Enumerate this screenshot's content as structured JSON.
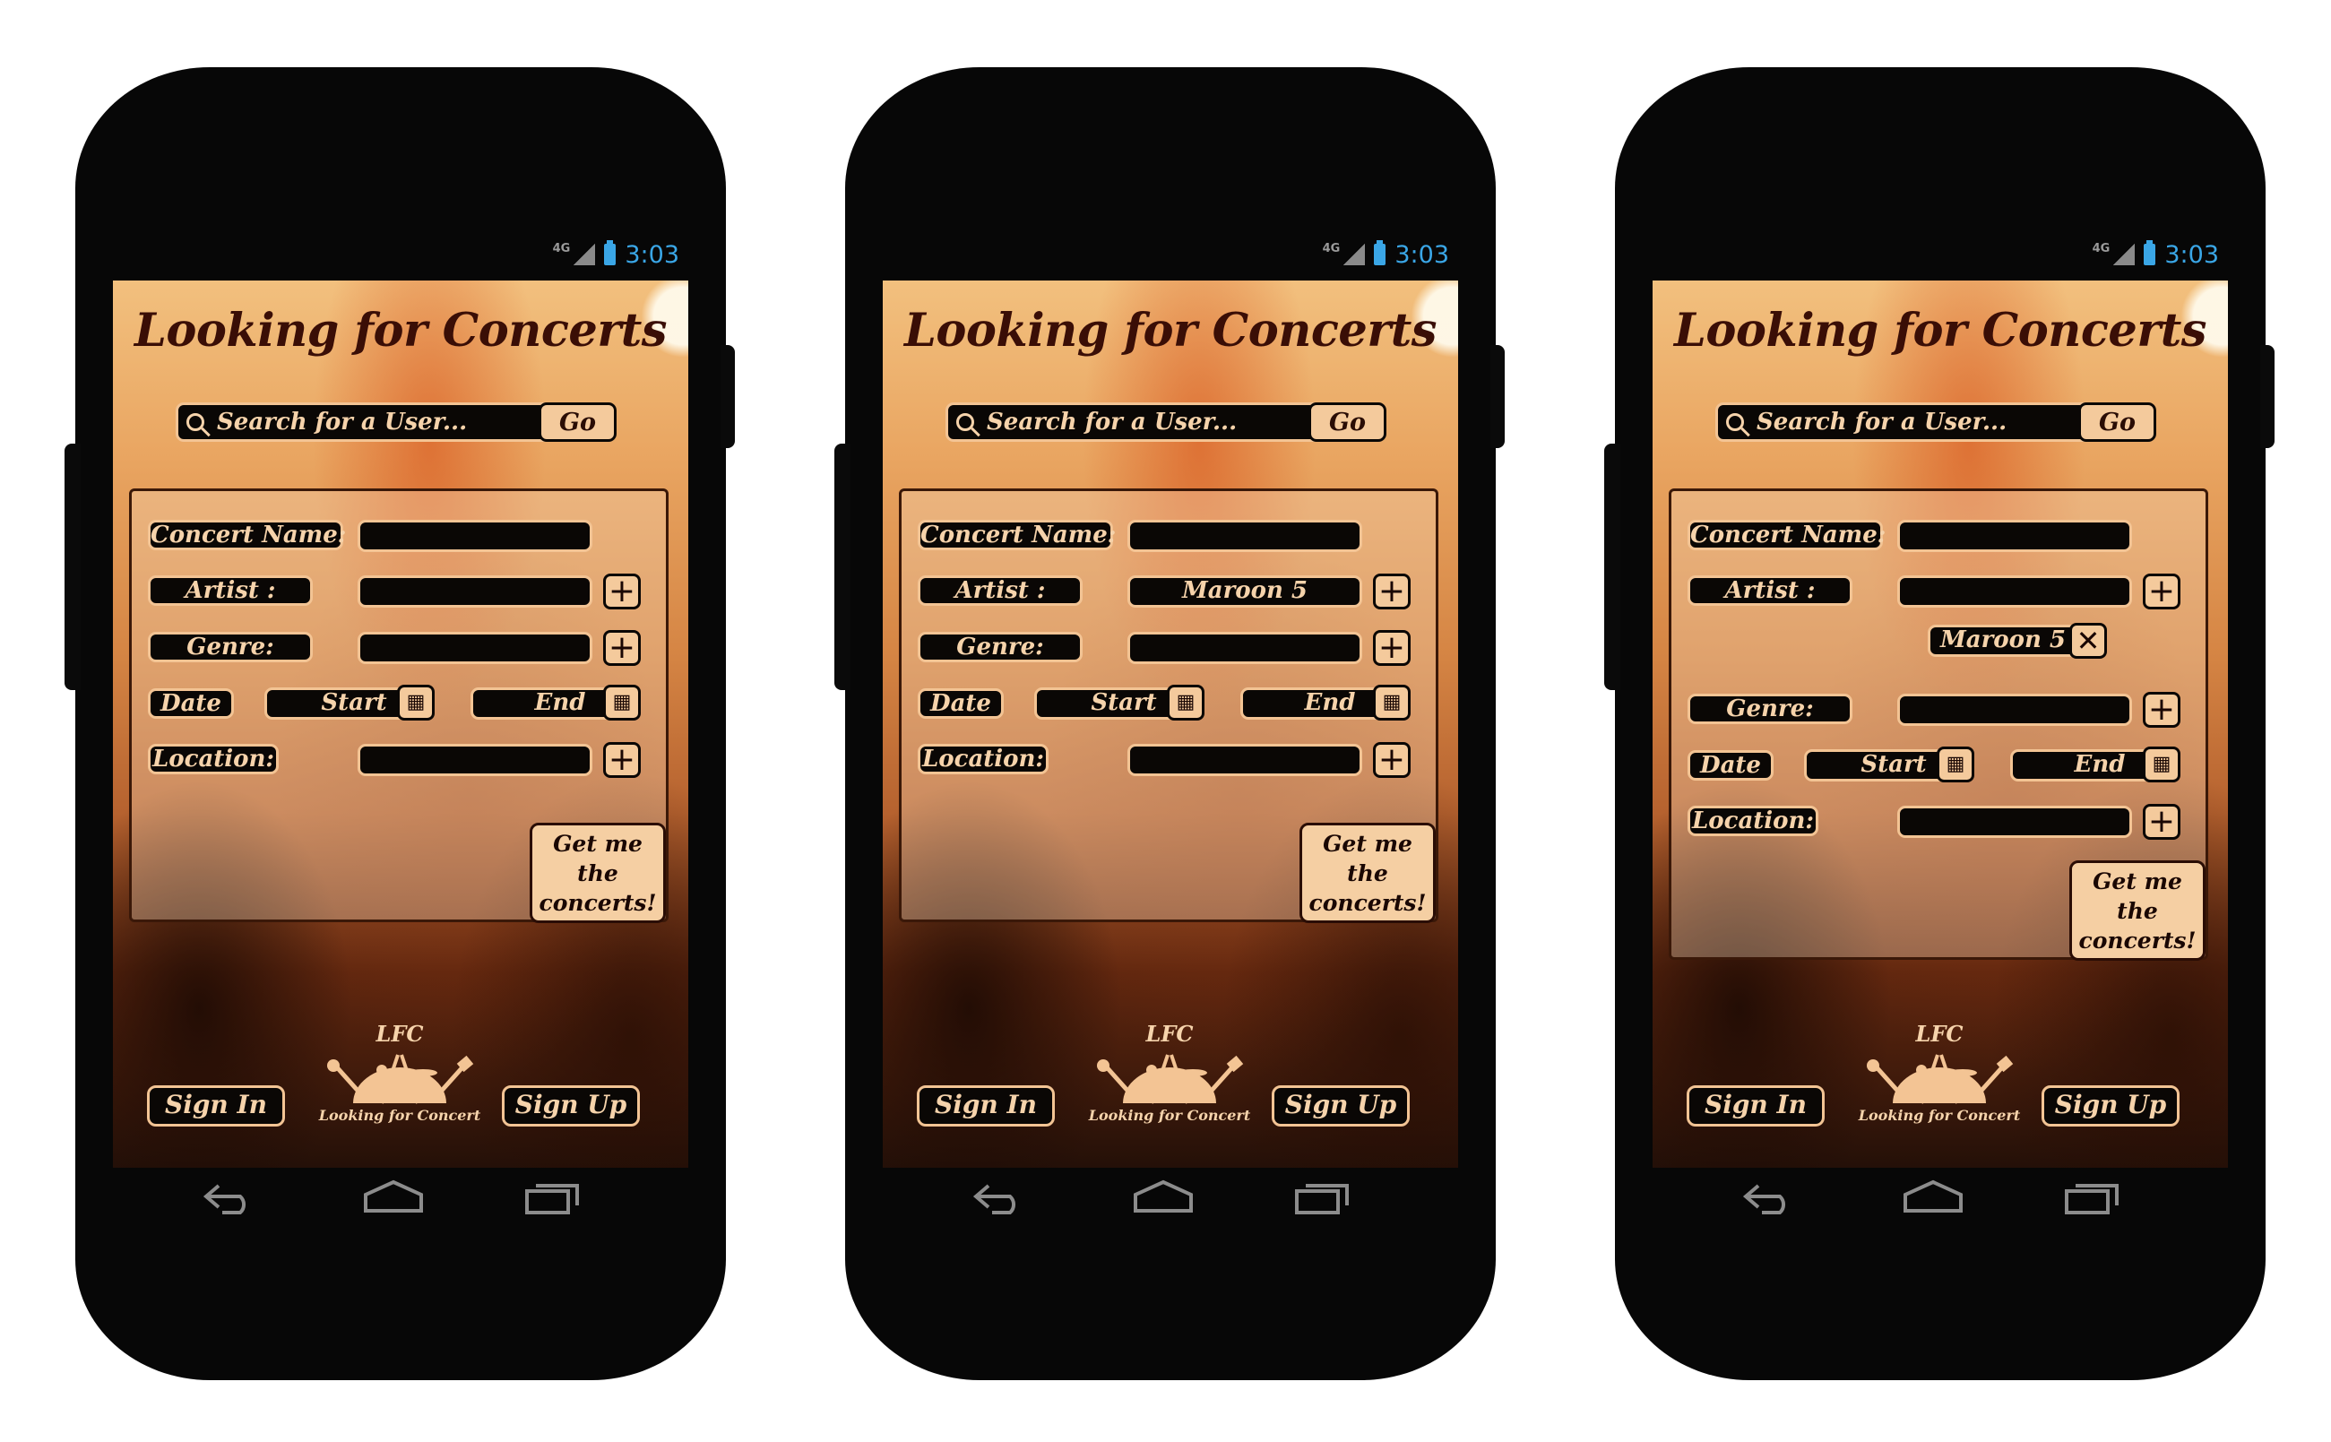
{
  "status_bar": {
    "network": "4G",
    "time": "3:03"
  },
  "screen": {
    "title": "Looking for Concerts",
    "search": {
      "placeholder": "Search for a User...",
      "go_label": "Go"
    },
    "form": {
      "concert_name_label": "Concert Name:",
      "artist_label": "Artist :",
      "genre_label": "Genre:",
      "date_label": "Date",
      "start_label": "Start",
      "end_label": "End",
      "location_label": "Location:",
      "submit_label": "Get me the concerts!"
    },
    "footer": {
      "sign_in_label": "Sign In",
      "sign_up_label": "Sign Up",
      "logo_monogram": "LFC",
      "logo_text": "Looking for Concert"
    }
  },
  "variants": [
    {
      "artist_value": ""
    },
    {
      "artist_value": "Maroon 5"
    },
    {
      "artist_value": "",
      "selected_artist_chip": "Maroon 5"
    }
  ],
  "colors": {
    "phone_body": "#070707",
    "title_text": "#3a0e06",
    "field_bg": "#0a0705",
    "field_border": "#f3c494",
    "button_bg": "#f4ca9c",
    "status_accent": "#3aa6e6"
  },
  "icons": [
    "search-icon",
    "plus-icon",
    "calendar-icon",
    "close-icon",
    "back-icon",
    "home-icon",
    "recent-apps-icon",
    "signal-icon",
    "battery-icon"
  ]
}
